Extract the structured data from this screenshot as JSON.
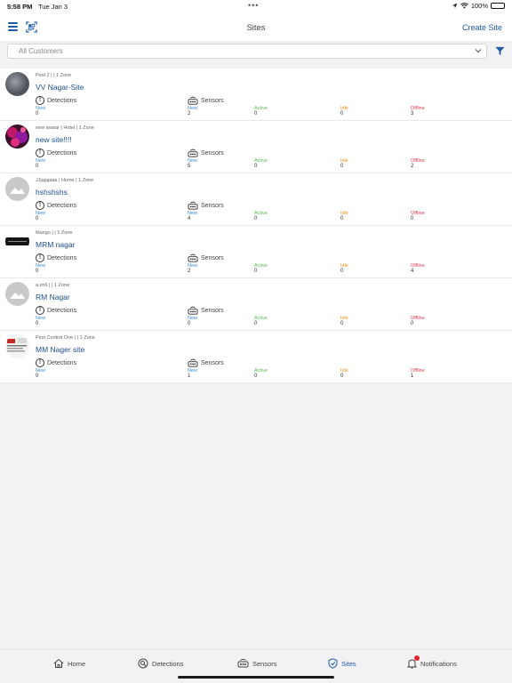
{
  "status_bar": {
    "time": "5:58 PM",
    "date": "Tue Jan 3",
    "battery": "100%"
  },
  "header": {
    "title": "Sites",
    "create_label": "Create Site"
  },
  "filter": {
    "selected": "All Customers"
  },
  "labels": {
    "detections": "Detections",
    "sensors": "Sensors",
    "new": "New",
    "active": "Active",
    "idle": "Idle",
    "offline": "Offline"
  },
  "sites": [
    {
      "meta": "Pest 2 |  | 1 Zone",
      "name": "VV Nagar-Site",
      "avatar": "grey-photo",
      "detections_new": "0",
      "sensors_new": "2",
      "sensors_active": "0",
      "sensors_idle": "0",
      "sensors_offline": "3"
    },
    {
      "meta": "new avatar | Hotel | 1 Zone",
      "name": "new site!!!!",
      "avatar": "magenta-photo",
      "detections_new": "0",
      "sensors_new": "5",
      "sensors_active": "0",
      "sensors_idle": "0",
      "sensors_offline": "2"
    },
    {
      "meta": "JJjajajaaa | Home | 1 Zone",
      "name": "hshshshs",
      "avatar": "placeholder-image",
      "detections_new": "0",
      "sensors_new": "4",
      "sensors_active": "0",
      "sensors_idle": "0",
      "sensors_offline": "0"
    },
    {
      "meta": "Mango |  | 1 Zone",
      "name": "MRM nagar",
      "avatar": "dark-banner",
      "detections_new": "0",
      "sensors_new": "2",
      "sensors_active": "0",
      "sensors_idle": "0",
      "sensors_offline": "4"
    },
    {
      "meta": "a.zn6 |  | 1 Zone",
      "name": "RM Nagar",
      "avatar": "placeholder-image",
      "detections_new": "0",
      "sensors_new": "0",
      "sensors_active": "0",
      "sensors_idle": "0",
      "sensors_offline": "0"
    },
    {
      "meta": "Pest Control One |  | 1 Zone",
      "name": "MM Nager site",
      "avatar": "document-thumbnail",
      "detections_new": "0",
      "sensors_new": "1",
      "sensors_active": "0",
      "sensors_idle": "0",
      "sensors_offline": "1"
    }
  ],
  "tabs": [
    {
      "label": "Home",
      "icon": "home-icon"
    },
    {
      "label": "Detections",
      "icon": "detections-icon"
    },
    {
      "label": "Sensors",
      "icon": "sensor-icon"
    },
    {
      "label": "Sites",
      "icon": "sites-icon",
      "active": true
    },
    {
      "label": "Notifications",
      "icon": "bell-icon"
    }
  ],
  "colors": {
    "accent": "#1e5aa8",
    "new": "#3b8fd6",
    "active": "#5cb85c",
    "idle": "#f0901e",
    "offline": "#e53950"
  }
}
